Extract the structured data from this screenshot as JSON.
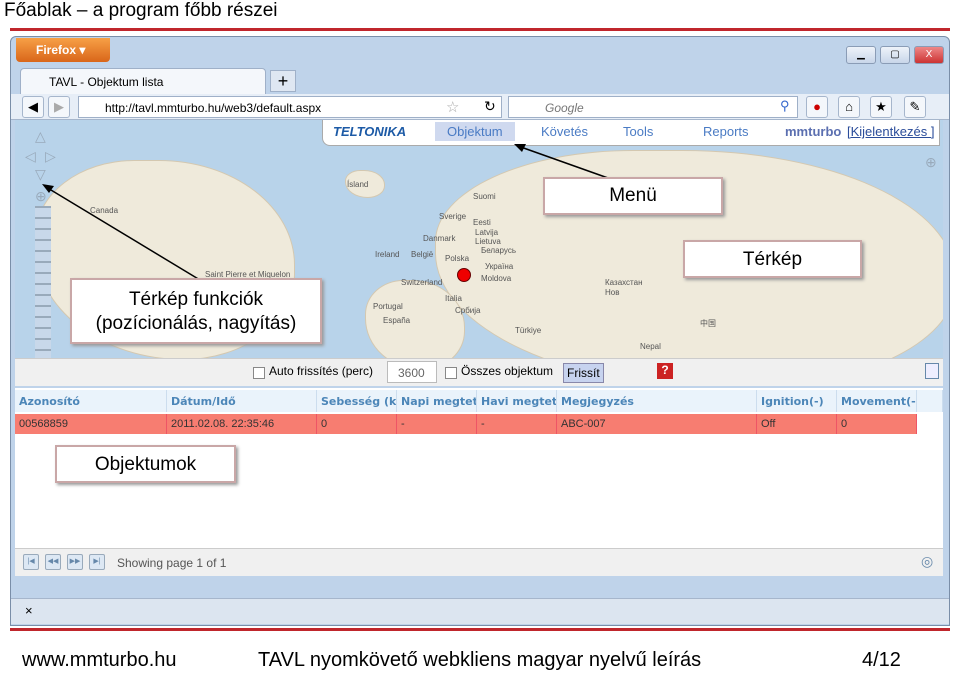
{
  "page_title": "Főablak – a program főbb részei",
  "browser": {
    "menu_button": "Firefox ▾",
    "tab_title": "TAVL - Objektum lista",
    "url": "http://tavl.mmturbo.hu/web3/default.aspx",
    "search_placeholder": "Google"
  },
  "app": {
    "logo": "TELTONIKA",
    "menu": [
      "Objektum",
      "Követés",
      "Tools",
      "Reports"
    ],
    "user": "mmturbo",
    "logout": "[Kijelentkezés ]",
    "map_labels": [
      "Canada",
      "Ísland",
      "Suomi",
      "Sverige",
      "Eesti",
      "Latvija",
      "Lietuva",
      "Danmark",
      "Беларусь",
      "Ireland",
      "België",
      "Polska",
      "Україна",
      "Moldova",
      "Switzerland",
      "Italia",
      "Portugal",
      "España",
      "Србија",
      "Казахстан",
      "Türkiye",
      "Нов",
      "中国",
      "Nepal",
      "Saint Pierre et Miquelon"
    ],
    "toolbar": {
      "auto_refresh": "Auto frissítés (perc)",
      "interval": "3600",
      "all_objects": "Összes objektum",
      "refresh": "Frissít",
      "help": "?"
    },
    "table": {
      "columns": [
        "Azonosító",
        "Dátum/Idő",
        "Sebesség (km",
        "Napi megtet",
        "Havi megtet",
        "Megjegyzés",
        "Ignition(-)",
        "Movement(-)"
      ],
      "rows": [
        [
          "00568859",
          "2011.02.08. 22:35:46",
          "0",
          "-",
          "-",
          "ABC-007",
          "Off",
          "0"
        ]
      ],
      "row_color": "#f77d71"
    },
    "pager": "Showing page 1 of 1"
  },
  "callouts": {
    "menu": "Menü",
    "map": "Térkép",
    "map_functions_1": "Térkép funkciók",
    "map_functions_2": "(pozícionálás, nagyítás)",
    "objects": "Objektumok"
  },
  "footer": {
    "site": "www.mmturbo.hu",
    "doc": "TAVL nyomkövető webkliens magyar nyelvű leírás",
    "page": "4/12"
  },
  "accent": "#c0262c"
}
